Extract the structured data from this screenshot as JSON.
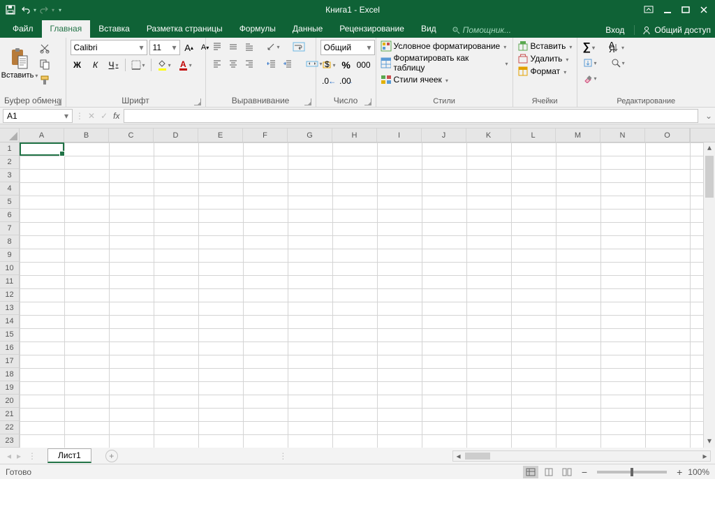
{
  "title": "Книга1 - Excel",
  "qat": {
    "save": "save",
    "undo": "undo",
    "redo": "redo"
  },
  "tabs": {
    "file": "Файл",
    "home": "Главная",
    "insert": "Вставка",
    "layout": "Разметка страницы",
    "formulas": "Формулы",
    "data": "Данные",
    "review": "Рецензирование",
    "view": "Вид"
  },
  "tell_me": "Помощник...",
  "sign_in": "Вход",
  "share": "Общий доступ",
  "ribbon": {
    "clipboard": {
      "paste": "Вставить",
      "label": "Буфер обмена"
    },
    "font": {
      "name": "Calibri",
      "size": "11",
      "bold": "Ж",
      "italic": "К",
      "underline": "Ч",
      "label": "Шрифт"
    },
    "alignment": {
      "label": "Выравнивание"
    },
    "number": {
      "format": "Общий",
      "label": "Число"
    },
    "styles": {
      "cond": "Условное форматирование",
      "table": "Форматировать как таблицу",
      "cell": "Стили ячеек",
      "label": "Стили"
    },
    "cells": {
      "insert": "Вставить",
      "delete": "Удалить",
      "format": "Формат",
      "label": "Ячейки"
    },
    "editing": {
      "label": "Редактирование"
    }
  },
  "name_box": "A1",
  "columns": [
    "A",
    "B",
    "C",
    "D",
    "E",
    "F",
    "G",
    "H",
    "I",
    "J",
    "K",
    "L",
    "M",
    "N",
    "O"
  ],
  "rows": [
    "1",
    "2",
    "3",
    "4",
    "5",
    "6",
    "7",
    "8",
    "9",
    "10",
    "11",
    "12",
    "13",
    "14",
    "15",
    "16",
    "17",
    "18",
    "19",
    "20",
    "21",
    "22",
    "23"
  ],
  "sheet_tab": "Лист1",
  "status_text": "Готово",
  "zoom": "100%"
}
